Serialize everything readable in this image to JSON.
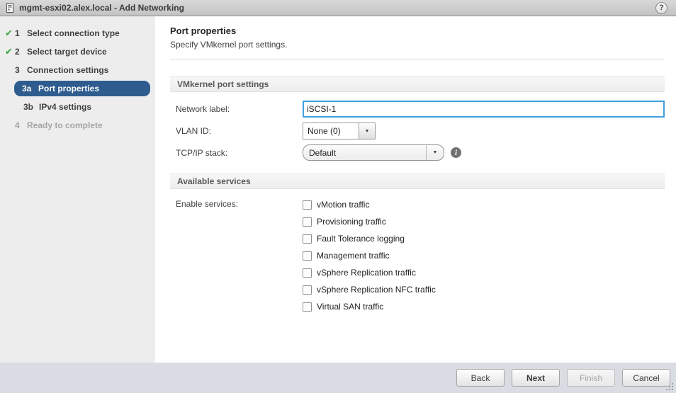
{
  "window": {
    "title": "mgmt-esxi02.alex.local - Add Networking",
    "help_label": "?"
  },
  "steps": [
    {
      "num": "1",
      "label": "Select connection type",
      "state": "done"
    },
    {
      "num": "2",
      "label": "Select target device",
      "state": "done"
    },
    {
      "num": "3",
      "label": "Connection settings",
      "state": "active-parent"
    },
    {
      "num": "3a",
      "label": "Port properties",
      "state": "current"
    },
    {
      "num": "3b",
      "label": "IPv4 settings",
      "state": "upcoming"
    },
    {
      "num": "4",
      "label": "Ready to complete",
      "state": "disabled"
    }
  ],
  "main": {
    "heading": "Port properties",
    "subheading": "Specify VMkernel port settings.",
    "vmkernel_section_title": "VMkernel port settings",
    "network_label": {
      "label": "Network label:",
      "value": "iSCSI-1"
    },
    "vlan": {
      "label": "VLAN ID:",
      "value": "None (0)"
    },
    "tcpip": {
      "label": "TCP/IP stack:",
      "value": "Default"
    },
    "services_section_title": "Available services",
    "enable_services_label": "Enable services:",
    "services": [
      "vMotion traffic",
      "Provisioning traffic",
      "Fault Tolerance logging",
      "Management traffic",
      "vSphere Replication traffic",
      "vSphere Replication NFC traffic",
      "Virtual SAN traffic"
    ],
    "services_checked": [
      false,
      false,
      false,
      false,
      false,
      false,
      false
    ]
  },
  "footer": {
    "back": "Back",
    "next": "Next",
    "finish": "Finish",
    "cancel": "Cancel"
  },
  "colors": {
    "selected_step_bg": "#2e5c8e",
    "focused_input_border": "#41a0df",
    "step_check_green": "#3da53d",
    "info_icon_gray": "#717171",
    "footer_bg": "#d9dde3"
  }
}
